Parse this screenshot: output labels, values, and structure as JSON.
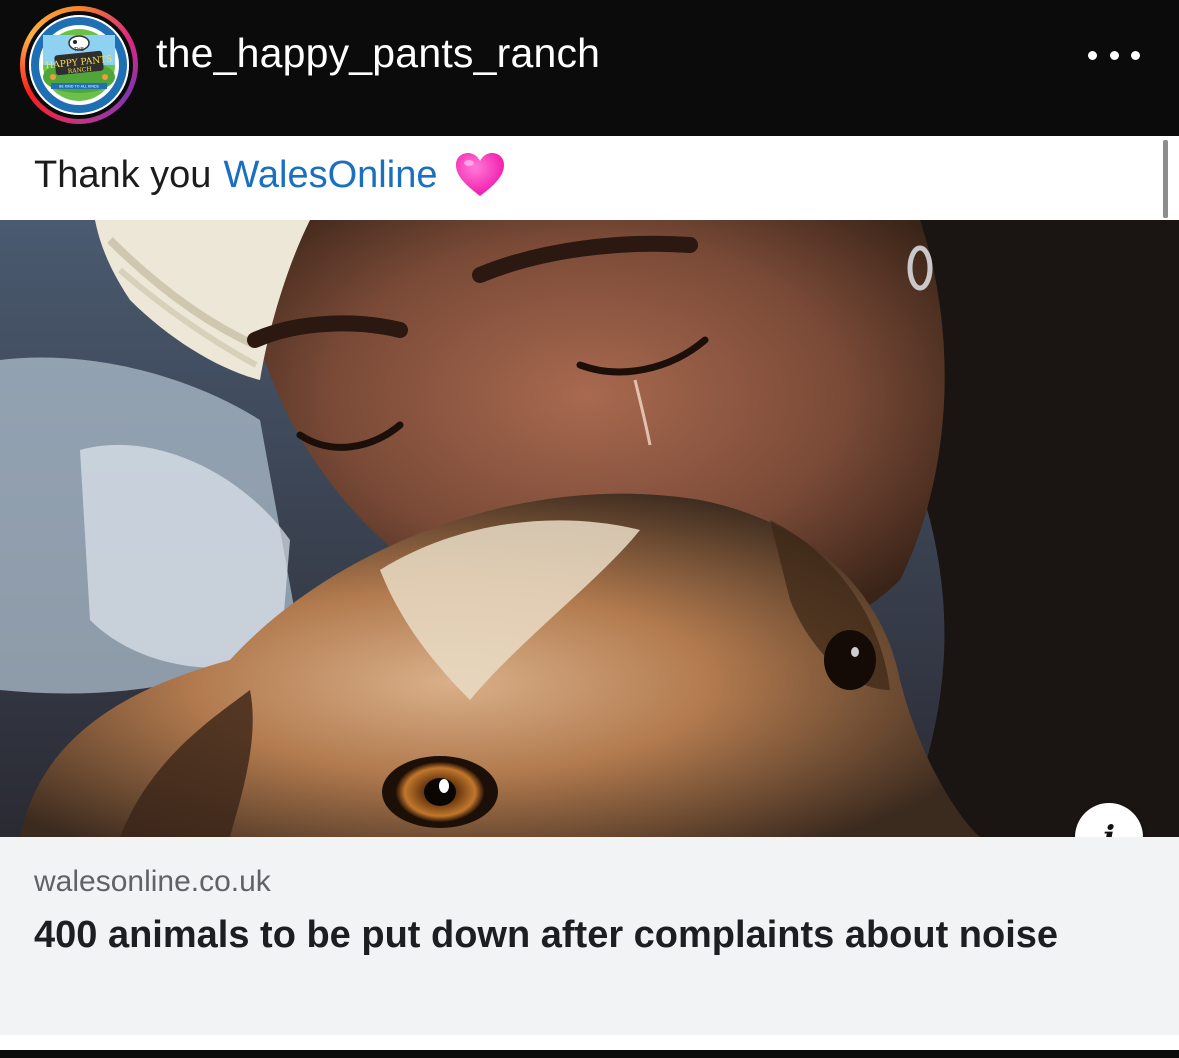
{
  "header": {
    "username": "the_happy_pants_ranch",
    "avatar_icon": "happy-pants-ranch-logo"
  },
  "post": {
    "caption_prefix": "Thank you",
    "caption_link": "WalesOnline",
    "caption_emoji": "pink-heart-icon",
    "link_preview": {
      "domain": "walesonline.co.uk",
      "headline": "400 animals to be put down after complaints about noise",
      "info_icon": "info-icon"
    }
  },
  "colors": {
    "link": "#1a6fc0",
    "header_bg": "#0b0b0b",
    "preview_bg": "#f2f3f5"
  },
  "logo_text": [
    "THE",
    "HAPPY PANTS",
    "RANCH",
    "BE KIND TO ALL KINDS"
  ]
}
